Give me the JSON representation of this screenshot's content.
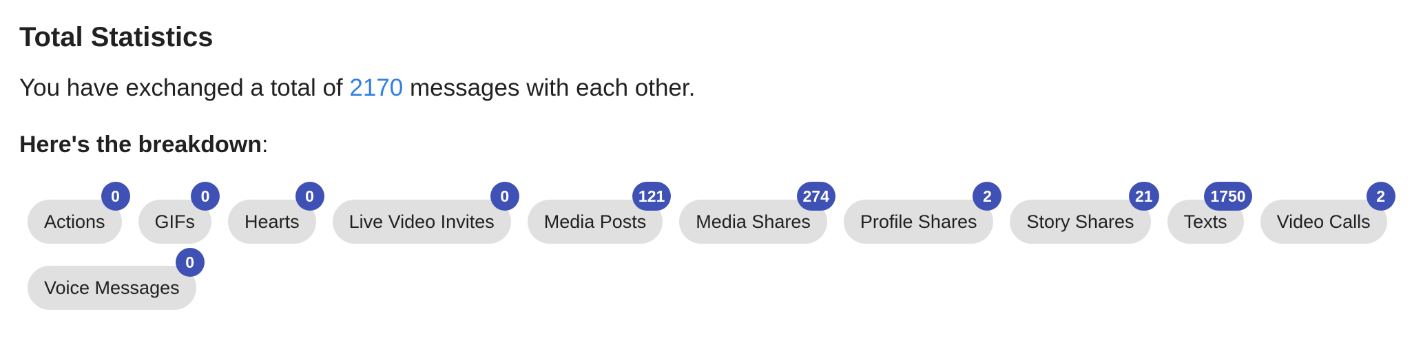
{
  "header": {
    "title": "Total Statistics"
  },
  "summary": {
    "prefix": "You have exchanged a total of ",
    "total": "2170",
    "suffix": " messages with each other."
  },
  "breakdown": {
    "label": "Here's the breakdown",
    "colon": ":"
  },
  "chips": [
    {
      "label": "Actions",
      "count": "0"
    },
    {
      "label": "GIFs",
      "count": "0"
    },
    {
      "label": "Hearts",
      "count": "0"
    },
    {
      "label": "Live Video Invites",
      "count": "0"
    },
    {
      "label": "Media Posts",
      "count": "121"
    },
    {
      "label": "Media Shares",
      "count": "274"
    },
    {
      "label": "Profile Shares",
      "count": "2"
    },
    {
      "label": "Story Shares",
      "count": "21"
    },
    {
      "label": "Texts",
      "count": "1750"
    },
    {
      "label": "Video Calls",
      "count": "2"
    },
    {
      "label": "Voice Messages",
      "count": "0"
    }
  ],
  "colors": {
    "accent": "#2f7ee6",
    "badge": "#3f51b5",
    "chip_bg": "#e0e0e0",
    "text": "#212121"
  }
}
